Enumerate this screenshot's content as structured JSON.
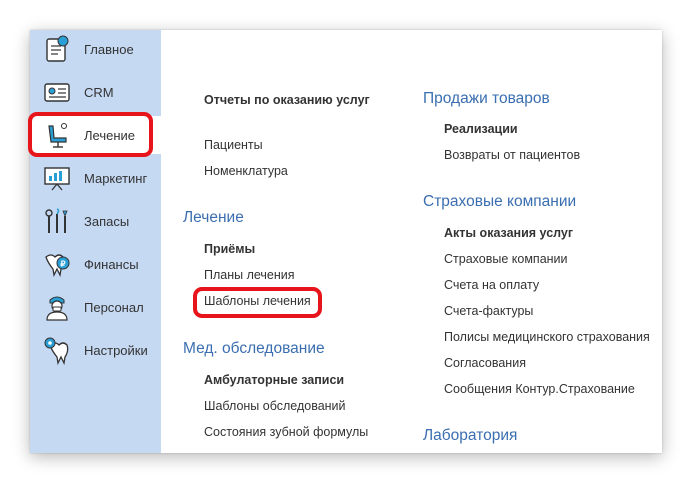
{
  "sidebar": {
    "items": [
      {
        "label": "Главное",
        "icon": "dashboard-icon"
      },
      {
        "label": "CRM",
        "icon": "id-card-icon"
      },
      {
        "label": "Лечение",
        "icon": "dental-chair-icon",
        "active": true
      },
      {
        "label": "Маркетинг",
        "icon": "presentation-board-icon"
      },
      {
        "label": "Запасы",
        "icon": "dental-tools-icon"
      },
      {
        "label": "Финансы",
        "icon": "tooth-coin-icon"
      },
      {
        "label": "Персонал",
        "icon": "doctor-icon"
      },
      {
        "label": "Настройки",
        "icon": "tooth-gear-icon"
      }
    ]
  },
  "main": {
    "col1": {
      "top_link": "Отчеты по оказанию услуг",
      "top_items": [
        "Пациенты",
        "Номенклатура"
      ],
      "section_treatment": {
        "title": "Лечение",
        "items": [
          "Приёмы",
          "Планы лечения",
          "Шаблоны лечения"
        ]
      },
      "section_exam": {
        "title": "Мед. обследование",
        "items": [
          "Амбулаторные записи",
          "Шаблоны обследований",
          "Состояния зубной формулы"
        ]
      }
    },
    "col2": {
      "section_sales": {
        "title": "Продажи товаров",
        "items": [
          "Реализации",
          "Возвраты от пациентов"
        ]
      },
      "section_insurance": {
        "title": "Страховые компании",
        "items": [
          "Акты оказания услуг",
          "Страховые компании",
          "Счета на оплату",
          "Счета-фактуры",
          "Полисы медицинского страхования",
          "Согласования",
          "Сообщения Контур.Страхование"
        ]
      },
      "section_lab": {
        "title": "Лаборатория"
      }
    }
  },
  "colors": {
    "sidebar_bg": "#c5d9f3",
    "section_header": "#3a6eb0",
    "highlight": "#e8141c",
    "icon_accent": "#2a9fd6"
  }
}
